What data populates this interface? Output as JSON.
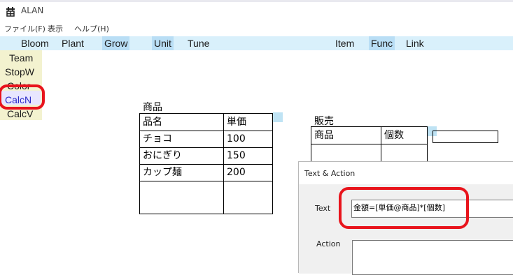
{
  "window": {
    "title": "ALAN",
    "icon": "tree-icon"
  },
  "menu": [
    "ファイル(F)",
    "表示",
    "ヘルプ(H)"
  ],
  "toolbar": {
    "left": [
      "Bloom",
      "Plant",
      "Grow",
      "Unit",
      "Tune"
    ],
    "right": [
      "Item",
      "Func",
      "Link"
    ]
  },
  "left_panel": [
    "Team",
    "StopW",
    "Color",
    "CalcN",
    "CalcV"
  ],
  "product_table": {
    "title": "商品",
    "headers": [
      "品名",
      "単価"
    ],
    "rows": [
      [
        "チョコ",
        "100"
      ],
      [
        "おにぎり",
        "150"
      ],
      [
        "カップ麺",
        "200"
      ]
    ]
  },
  "sales_table": {
    "title": "販売",
    "headers": [
      "商品",
      "個数"
    ]
  },
  "dialog": {
    "title": "Text & Action",
    "text_label": "Text",
    "text_value": "金額=[単価@商品]*[個数]",
    "action_label": "Action"
  },
  "colors": {
    "toolbar_bg": "#d9f0fb",
    "left_panel_bg": "#f3f2cf",
    "highlight_red": "#e8141c"
  }
}
